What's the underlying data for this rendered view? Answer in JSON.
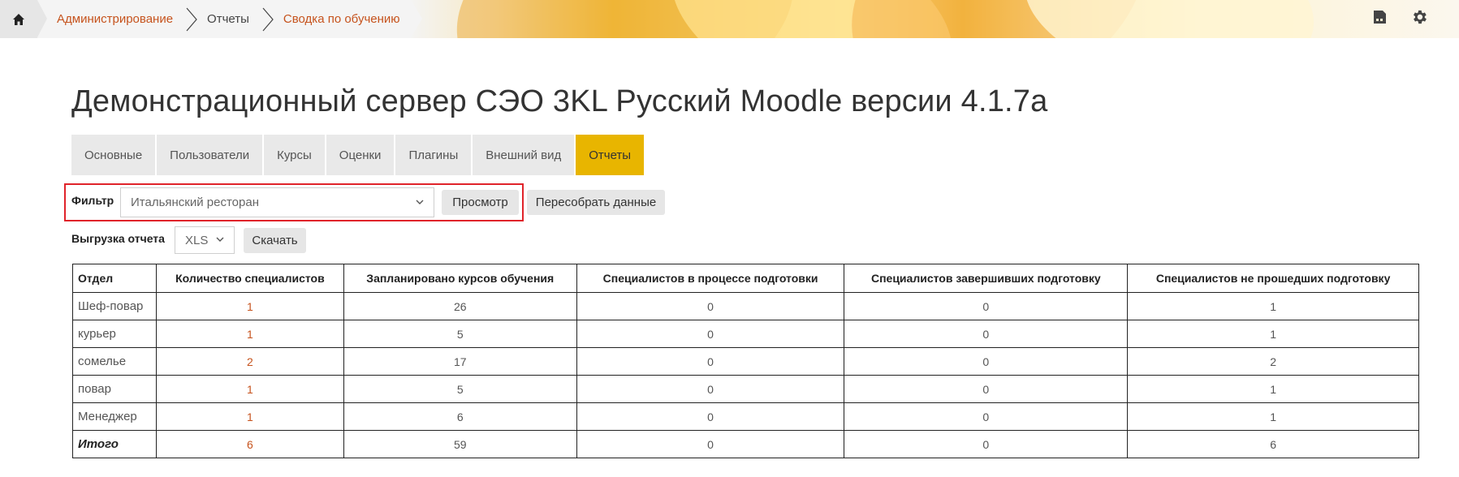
{
  "breadcrumb": [
    {
      "label": "Администрирование",
      "link": true
    },
    {
      "label": "Отчеты",
      "link": false
    },
    {
      "label": "Сводка по обучению",
      "link": true
    }
  ],
  "header": {
    "title": "Демонстрационный сервер СЭО 3KL Русский Moodle версии 4.1.7a"
  },
  "tabs": [
    {
      "label": "Основные",
      "active": false
    },
    {
      "label": "Пользователи",
      "active": false
    },
    {
      "label": "Курсы",
      "active": false
    },
    {
      "label": "Оценки",
      "active": false
    },
    {
      "label": "Плагины",
      "active": false
    },
    {
      "label": "Внешний вид",
      "active": false
    },
    {
      "label": "Отчеты",
      "active": true
    }
  ],
  "filter": {
    "label": "Фильтр",
    "selected": "Итальянский ресторан",
    "view_button": "Просмотр",
    "rebuild_button": "Пересобрать данные"
  },
  "export": {
    "label": "Выгрузка отчета",
    "format": "XLS",
    "download_button": "Скачать"
  },
  "table": {
    "headers": [
      "Отдел",
      "Количество специалистов",
      "Запланировано курсов обучения",
      "Специалистов в процессе подготовки",
      "Специалистов завершивших подготовку",
      "Специалистов не прошедших подготовку"
    ],
    "rows": [
      [
        "Шеф-повар",
        "1",
        "26",
        "0",
        "0",
        "1"
      ],
      [
        "курьер",
        "1",
        "5",
        "0",
        "0",
        "1"
      ],
      [
        "сомелье",
        "2",
        "17",
        "0",
        "0",
        "2"
      ],
      [
        "повар",
        "1",
        "5",
        "0",
        "0",
        "1"
      ],
      [
        "Менеджер",
        "1",
        "6",
        "0",
        "0",
        "1"
      ]
    ],
    "total": [
      "Итого",
      "6",
      "59",
      "0",
      "0",
      "6"
    ]
  },
  "colors": {
    "accent": "#e8b500",
    "link": "#c6531d",
    "highlight_border": "#e0232a"
  }
}
